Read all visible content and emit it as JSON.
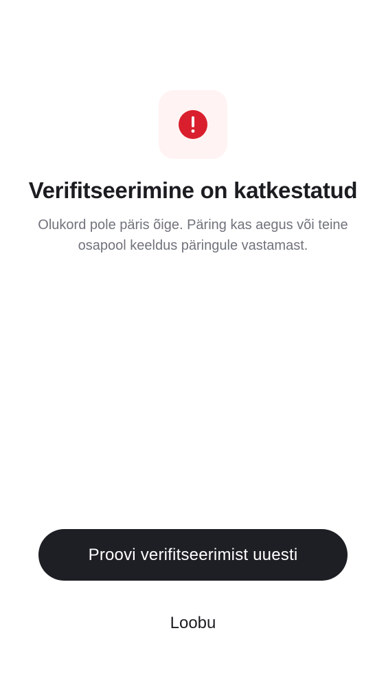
{
  "status": {
    "icon": "error-exclamation-icon",
    "accent_color": "#d91f2d",
    "icon_bg_color": "#fff4f3"
  },
  "message": {
    "title": "Verifitseerimine on katkestatud",
    "body": "Olukord pole päris õige. Päring kas aegus või teine osapool keeldus päringule vastamast."
  },
  "actions": {
    "retry_label": "Proovi verifitseerimist uuesti",
    "cancel_label": "Loobu"
  }
}
